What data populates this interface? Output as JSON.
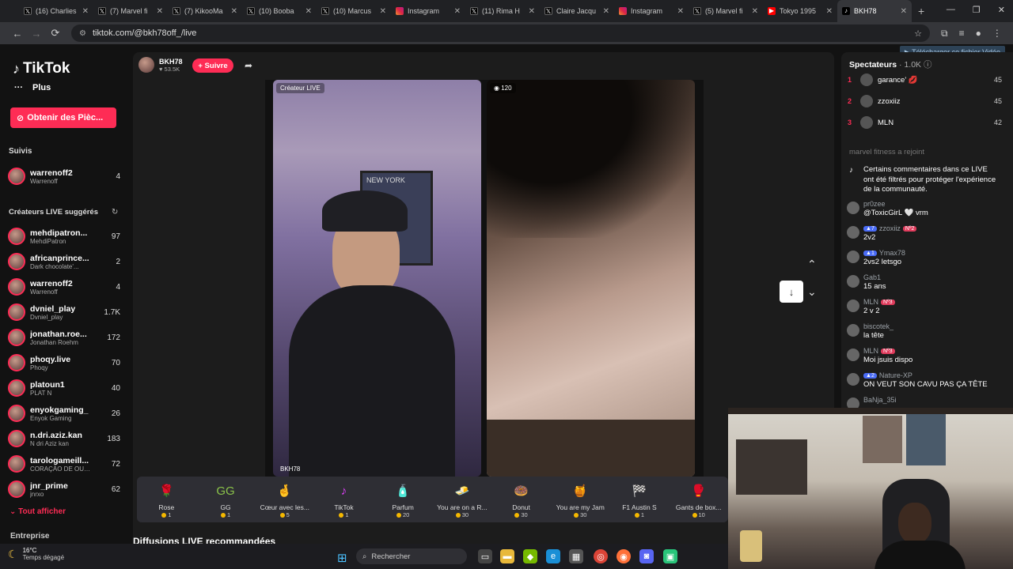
{
  "browser": {
    "tabs": [
      {
        "label": "(16) Charlies",
        "icon": "x-logo-icon"
      },
      {
        "label": "(7) Marvel fi",
        "icon": "x-logo-icon"
      },
      {
        "label": "(7) KikooMa",
        "icon": "x-logo-icon"
      },
      {
        "label": "(10) Booba",
        "icon": "x-logo-icon"
      },
      {
        "label": "(10) Marcus",
        "icon": "x-logo-icon"
      },
      {
        "label": "Instagram",
        "icon": "instagram-icon"
      },
      {
        "label": "(11) Rima H",
        "icon": "x-logo-icon"
      },
      {
        "label": "Claire Jacqu",
        "icon": "x-logo-icon"
      },
      {
        "label": "Instagram",
        "icon": "instagram-icon"
      },
      {
        "label": "(5) Marvel fi",
        "icon": "x-logo-icon"
      },
      {
        "label": "Tokyo 1995",
        "icon": "youtube-icon"
      },
      {
        "label": "BKH78",
        "icon": "tiktok-icon",
        "active": true
      }
    ],
    "url": "tiktok.com/@bkh78off_/live",
    "download_label": "Télécharger ce fichier Vidéo"
  },
  "sidebar": {
    "logo": "TikTok",
    "more_label": "Plus",
    "coins_label": "Obtenir des Pièc...",
    "followed_title": "Suivis",
    "followed": [
      {
        "name": "warrenoff2",
        "sub": "Warrenoff",
        "count": "4"
      }
    ],
    "suggested_title": "Créateurs LIVE suggérés",
    "creators": [
      {
        "name": "mehdipatron...",
        "sub": "MehdiPatron",
        "count": "97"
      },
      {
        "name": "africanprince...",
        "sub": "Dark chocolate'...",
        "count": "2"
      },
      {
        "name": "warrenoff2",
        "sub": "Warrenoff",
        "count": "4"
      },
      {
        "name": "dvniel_play",
        "sub": "Dvniel_play",
        "count": "1.7K"
      },
      {
        "name": "jonathan.roe...",
        "sub": "Jonathan Roehm",
        "count": "172"
      },
      {
        "name": "phoqy.live",
        "sub": "Phoqy",
        "count": "70"
      },
      {
        "name": "platoun1",
        "sub": "PLAT N",
        "count": "40"
      },
      {
        "name": "enyokgaming_",
        "sub": "Enyok Gaming",
        "count": "26"
      },
      {
        "name": "n.dri.aziz.kan",
        "sub": "N dri Aziz kan",
        "count": "183"
      },
      {
        "name": "tarologameill...",
        "sub": "CORAÇÃO DE OUR...",
        "count": "72"
      },
      {
        "name": "jnr_prime",
        "sub": "jnrxo",
        "count": "62"
      }
    ],
    "show_all": "Tout afficher",
    "enterprise": "Entreprise"
  },
  "stream": {
    "host_name": "BKH78",
    "host_likes": "53.5K",
    "follow_label": "+ Suivre",
    "left_label": "Créateur LIVE",
    "left_name": "BKH78",
    "right_viewers": "120",
    "recommended_title": "Diffusions LIVE recommandées"
  },
  "gifts": [
    {
      "name": "Rose",
      "price": "1",
      "emoji": "🌹",
      "color": "#c2185b"
    },
    {
      "name": "GG",
      "price": "1",
      "emoji": "GG",
      "color": "#8bc34a"
    },
    {
      "name": "Cœur avec les...",
      "price": "5",
      "emoji": "🤞",
      "color": "#f4a261"
    },
    {
      "name": "TikTok",
      "price": "1",
      "emoji": "♪",
      "color": "#e040fb"
    },
    {
      "name": "Parfum",
      "price": "20",
      "emoji": "🧴",
      "color": "#ec407a"
    },
    {
      "name": "You are on a R...",
      "price": "30",
      "emoji": "🧈",
      "color": "#f4d03f"
    },
    {
      "name": "Donut",
      "price": "30",
      "emoji": "🍩",
      "color": "#f48fb1"
    },
    {
      "name": "You are my Jam",
      "price": "30",
      "emoji": "🍯",
      "color": "#ff9800"
    },
    {
      "name": "F1 Austin S",
      "price": "1",
      "emoji": "🏁",
      "color": "#ddd"
    },
    {
      "name": "Gants de box...",
      "price": "10",
      "emoji": "🥊",
      "color": "#fdd835"
    }
  ],
  "chat": {
    "title": "Spectateurs",
    "viewers": "1.0K",
    "top": [
      {
        "rank": "1",
        "name": "garance' 💋",
        "score": "45"
      },
      {
        "rank": "2",
        "name": "zzoxiiz",
        "score": "45"
      },
      {
        "rank": "3",
        "name": "MLN",
        "score": "42"
      }
    ],
    "joined": "marvel fitness  a rejoint",
    "system": "Certains commentaires dans ce LIVE ont été filtrés pour protéger l'expérience de la communauté.",
    "messages": [
      {
        "user": "pr0zee",
        "badge": "",
        "text": "@ToxicGirL 🤍 vrm"
      },
      {
        "user": "zzoxiiz",
        "badge": "7",
        "rank": "Nº2",
        "text": "2v2"
      },
      {
        "user": "Ymax78",
        "badge": "1",
        "text": "2vs2 letsgo"
      },
      {
        "user": "Gab1",
        "badge": "",
        "text": "15 ans"
      },
      {
        "user": "MLN",
        "badge": "",
        "rank": "Nº3",
        "text": "2 v 2"
      },
      {
        "user": "biscotek_",
        "badge": "",
        "text": "la tête"
      },
      {
        "user": "MLN",
        "badge": "",
        "rank": "Nº3",
        "text": "Moi jsuis dispo"
      },
      {
        "user": "Nature-XP",
        "badge": "2",
        "text": "ON VEUT SON CAVU PAS ÇA TÊTE"
      },
      {
        "user": "BaNja_35i",
        "badge": "",
        "text": ""
      }
    ]
  },
  "taskbar": {
    "temp": "16°C",
    "weather": "Temps dégagé",
    "search": "Rechercher"
  }
}
